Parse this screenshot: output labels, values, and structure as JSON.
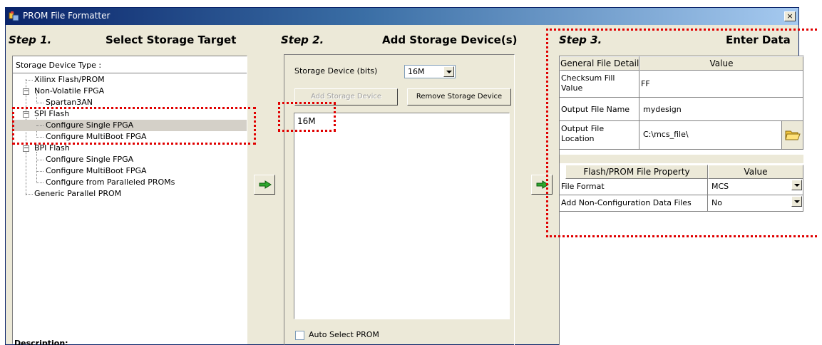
{
  "window": {
    "title": "PROM File Formatter",
    "close_glyph": "×"
  },
  "step1": {
    "step": "Step 1.",
    "label": "Select Storage Target",
    "tree_header": "Storage Device Type :",
    "items": [
      {
        "label": "Xilinx Flash/PROM"
      },
      {
        "label": "Non-Volatile FPGA"
      },
      {
        "label": "Spartan3AN"
      },
      {
        "label": "SPI Flash"
      },
      {
        "label": "Configure Single FPGA"
      },
      {
        "label": "Configure MultiBoot FPGA"
      },
      {
        "label": "BPI Flash"
      },
      {
        "label": "Configure Single FPGA"
      },
      {
        "label": "Configure MultiBoot FPGA"
      },
      {
        "label": "Configure from Paralleled PROMs"
      },
      {
        "label": "Generic Parallel PROM"
      }
    ]
  },
  "step2": {
    "step": "Step 2.",
    "label": "Add Storage Device(s)",
    "storage_device_label": "Storage Device (bits)",
    "storage_device_value": "16M",
    "add_button": "Add Storage Device",
    "remove_button": "Remove Storage Device",
    "device_list": [
      "16M"
    ],
    "auto_select": "Auto Select PROM"
  },
  "step3": {
    "step": "Step 3.",
    "label": "Enter Data",
    "general": {
      "col1": "General File Detail",
      "col2": "Value",
      "rows": [
        {
          "name": "Checksum Fill Value",
          "value": "FF"
        },
        {
          "name": "Output File Name",
          "value": "mydesign"
        },
        {
          "name": "Output File Location",
          "value": "C:\\mcs_file\\"
        }
      ]
    },
    "property": {
      "col1": "Flash/PROM File Property",
      "col2": "Value",
      "rows": [
        {
          "name": "File Format",
          "value": "MCS"
        },
        {
          "name": "Add Non-Configuration Data Files",
          "value": "No"
        }
      ]
    }
  },
  "description_label": "Description:",
  "colors": {
    "highlight_dots": "#e00000",
    "arrow": "#2ea82e",
    "folder": "#f2c640"
  }
}
